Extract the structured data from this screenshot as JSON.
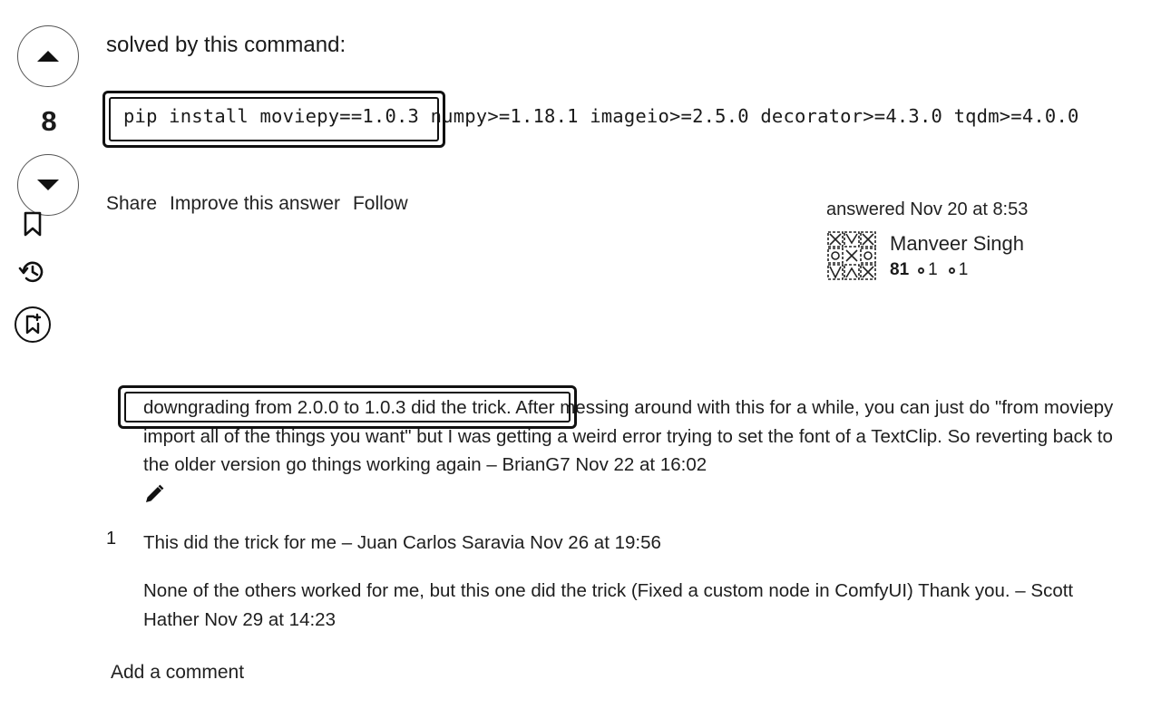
{
  "answer": {
    "intro_text": "solved by this command:",
    "command": "pip install moviepy==1.0.3 numpy>=1.18.1 imageio>=2.5.0 decorator>=4.3.0 tqdm>=4.0.0",
    "vote_count": "8",
    "actions": {
      "share": "Share",
      "improve": "Improve this answer",
      "follow": "Follow"
    }
  },
  "signature": {
    "answered_label": "answered Nov 20 at 8:53",
    "user_name": "Manveer Singh",
    "reputation": "81",
    "silver_badges": "1",
    "bronze_badges": "1"
  },
  "comments": [
    {
      "score": "",
      "text": "downgrading from 2.0.0 to 1.0.3 did the trick. After messing around with this for a while, you can just do \"from moviepy import all of the things you want\" but I was getting a weird error trying to set the font of a TextClip. So reverting back to the older version go things working again",
      "dash": " – ",
      "author": "BrianG7",
      "date": "Nov 22 at 16:02"
    },
    {
      "score": "1",
      "text": "This did the trick for me",
      "dash": " – ",
      "author": "Juan Carlos Saravia",
      "date": "Nov 26 at 19:56"
    },
    {
      "score": "",
      "text": "None of the others worked for me, but this one did the trick (Fixed a custom node in ComfyUI) Thank you.",
      "dash": " – ",
      "author": "Scott Hather",
      "date": "Nov 29 at 14:23"
    }
  ],
  "add_comment_label": "Add a comment",
  "icons": {
    "upvote": "triangle-up-icon",
    "downvote": "triangle-down-icon",
    "bookmark": "bookmark-icon",
    "history": "history-icon",
    "save": "bookmark-plus-icon",
    "edit": "pencil-icon"
  },
  "colors": {
    "text": "#1a1a1a",
    "highlight_border": "#111111"
  }
}
